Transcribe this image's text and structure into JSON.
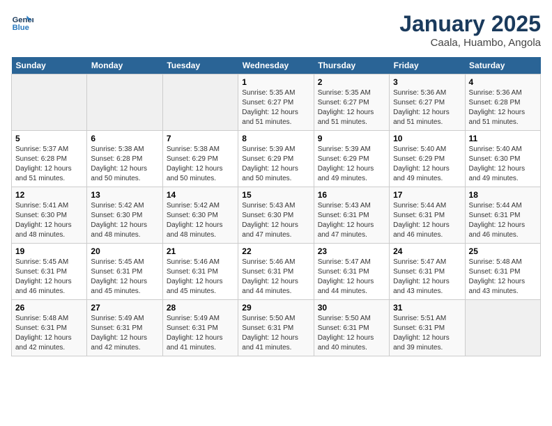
{
  "header": {
    "logo_line1": "General",
    "logo_line2": "Blue",
    "title": "January 2025",
    "subtitle": "Caala, Huambo, Angola"
  },
  "weekdays": [
    "Sunday",
    "Monday",
    "Tuesday",
    "Wednesday",
    "Thursday",
    "Friday",
    "Saturday"
  ],
  "weeks": [
    [
      {
        "day": "",
        "info": ""
      },
      {
        "day": "",
        "info": ""
      },
      {
        "day": "",
        "info": ""
      },
      {
        "day": "1",
        "info": "Sunrise: 5:35 AM\nSunset: 6:27 PM\nDaylight: 12 hours\nand 51 minutes."
      },
      {
        "day": "2",
        "info": "Sunrise: 5:35 AM\nSunset: 6:27 PM\nDaylight: 12 hours\nand 51 minutes."
      },
      {
        "day": "3",
        "info": "Sunrise: 5:36 AM\nSunset: 6:27 PM\nDaylight: 12 hours\nand 51 minutes."
      },
      {
        "day": "4",
        "info": "Sunrise: 5:36 AM\nSunset: 6:28 PM\nDaylight: 12 hours\nand 51 minutes."
      }
    ],
    [
      {
        "day": "5",
        "info": "Sunrise: 5:37 AM\nSunset: 6:28 PM\nDaylight: 12 hours\nand 51 minutes."
      },
      {
        "day": "6",
        "info": "Sunrise: 5:38 AM\nSunset: 6:28 PM\nDaylight: 12 hours\nand 50 minutes."
      },
      {
        "day": "7",
        "info": "Sunrise: 5:38 AM\nSunset: 6:29 PM\nDaylight: 12 hours\nand 50 minutes."
      },
      {
        "day": "8",
        "info": "Sunrise: 5:39 AM\nSunset: 6:29 PM\nDaylight: 12 hours\nand 50 minutes."
      },
      {
        "day": "9",
        "info": "Sunrise: 5:39 AM\nSunset: 6:29 PM\nDaylight: 12 hours\nand 49 minutes."
      },
      {
        "day": "10",
        "info": "Sunrise: 5:40 AM\nSunset: 6:29 PM\nDaylight: 12 hours\nand 49 minutes."
      },
      {
        "day": "11",
        "info": "Sunrise: 5:40 AM\nSunset: 6:30 PM\nDaylight: 12 hours\nand 49 minutes."
      }
    ],
    [
      {
        "day": "12",
        "info": "Sunrise: 5:41 AM\nSunset: 6:30 PM\nDaylight: 12 hours\nand 48 minutes."
      },
      {
        "day": "13",
        "info": "Sunrise: 5:42 AM\nSunset: 6:30 PM\nDaylight: 12 hours\nand 48 minutes."
      },
      {
        "day": "14",
        "info": "Sunrise: 5:42 AM\nSunset: 6:30 PM\nDaylight: 12 hours\nand 48 minutes."
      },
      {
        "day": "15",
        "info": "Sunrise: 5:43 AM\nSunset: 6:30 PM\nDaylight: 12 hours\nand 47 minutes."
      },
      {
        "day": "16",
        "info": "Sunrise: 5:43 AM\nSunset: 6:31 PM\nDaylight: 12 hours\nand 47 minutes."
      },
      {
        "day": "17",
        "info": "Sunrise: 5:44 AM\nSunset: 6:31 PM\nDaylight: 12 hours\nand 46 minutes."
      },
      {
        "day": "18",
        "info": "Sunrise: 5:44 AM\nSunset: 6:31 PM\nDaylight: 12 hours\nand 46 minutes."
      }
    ],
    [
      {
        "day": "19",
        "info": "Sunrise: 5:45 AM\nSunset: 6:31 PM\nDaylight: 12 hours\nand 46 minutes."
      },
      {
        "day": "20",
        "info": "Sunrise: 5:45 AM\nSunset: 6:31 PM\nDaylight: 12 hours\nand 45 minutes."
      },
      {
        "day": "21",
        "info": "Sunrise: 5:46 AM\nSunset: 6:31 PM\nDaylight: 12 hours\nand 45 minutes."
      },
      {
        "day": "22",
        "info": "Sunrise: 5:46 AM\nSunset: 6:31 PM\nDaylight: 12 hours\nand 44 minutes."
      },
      {
        "day": "23",
        "info": "Sunrise: 5:47 AM\nSunset: 6:31 PM\nDaylight: 12 hours\nand 44 minutes."
      },
      {
        "day": "24",
        "info": "Sunrise: 5:47 AM\nSunset: 6:31 PM\nDaylight: 12 hours\nand 43 minutes."
      },
      {
        "day": "25",
        "info": "Sunrise: 5:48 AM\nSunset: 6:31 PM\nDaylight: 12 hours\nand 43 minutes."
      }
    ],
    [
      {
        "day": "26",
        "info": "Sunrise: 5:48 AM\nSunset: 6:31 PM\nDaylight: 12 hours\nand 42 minutes."
      },
      {
        "day": "27",
        "info": "Sunrise: 5:49 AM\nSunset: 6:31 PM\nDaylight: 12 hours\nand 42 minutes."
      },
      {
        "day": "28",
        "info": "Sunrise: 5:49 AM\nSunset: 6:31 PM\nDaylight: 12 hours\nand 41 minutes."
      },
      {
        "day": "29",
        "info": "Sunrise: 5:50 AM\nSunset: 6:31 PM\nDaylight: 12 hours\nand 41 minutes."
      },
      {
        "day": "30",
        "info": "Sunrise: 5:50 AM\nSunset: 6:31 PM\nDaylight: 12 hours\nand 40 minutes."
      },
      {
        "day": "31",
        "info": "Sunrise: 5:51 AM\nSunset: 6:31 PM\nDaylight: 12 hours\nand 39 minutes."
      },
      {
        "day": "",
        "info": ""
      }
    ]
  ]
}
